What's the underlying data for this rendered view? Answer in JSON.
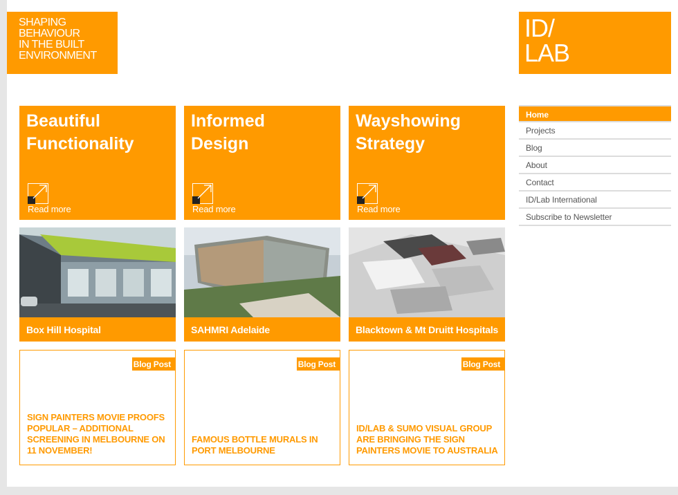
{
  "header": {
    "tagline_lines": [
      "SHAPING",
      "BEHAVIOUR",
      "IN THE BUILT",
      "ENVIRONMENT"
    ],
    "logo_lines": [
      "ID/",
      "LAB"
    ]
  },
  "colors": {
    "accent": "#ff9a00",
    "page_bg": "#ffffff",
    "outer_bg": "#e6e6e6"
  },
  "feature_tiles": [
    {
      "title_lines": [
        "Beautiful",
        "Functionality"
      ],
      "link": "Read more",
      "icon": "arrow-diagonal-icon"
    },
    {
      "title_lines": [
        "Informed",
        "Design"
      ],
      "link": "Read more",
      "icon": "arrow-diagonal-icon"
    },
    {
      "title_lines": [
        "Wayshowing",
        "Strategy"
      ],
      "link": "Read more",
      "icon": "arrow-diagonal-icon"
    }
  ],
  "projects": [
    {
      "caption": "Box Hill Hospital"
    },
    {
      "caption": "SAHMRI Adelaide"
    },
    {
      "caption": "Blacktown & Mt Druitt Hospitals"
    }
  ],
  "blog_posts": [
    {
      "badge": "Blog Post",
      "title": "SIGN PAINTERS MOVIE PROOFS POPULAR – ADDITIONAL SCREENING IN MELBOURNE ON 11 NOVEMBER!"
    },
    {
      "badge": "Blog Post",
      "title": "FAMOUS BOTTLE MURALS IN PORT MELBOURNE"
    },
    {
      "badge": "Blog Post",
      "title": "ID/LAB & SUMO VISUAL GROUP ARE BRINGING THE SIGN PAINTERS MOVIE TO AUSTRALIA"
    }
  ],
  "nav": {
    "items": [
      "Home",
      "Projects",
      "Blog",
      "About",
      "Contact",
      "ID/Lab International",
      "Subscribe to Newsletter"
    ],
    "active": "Home"
  }
}
